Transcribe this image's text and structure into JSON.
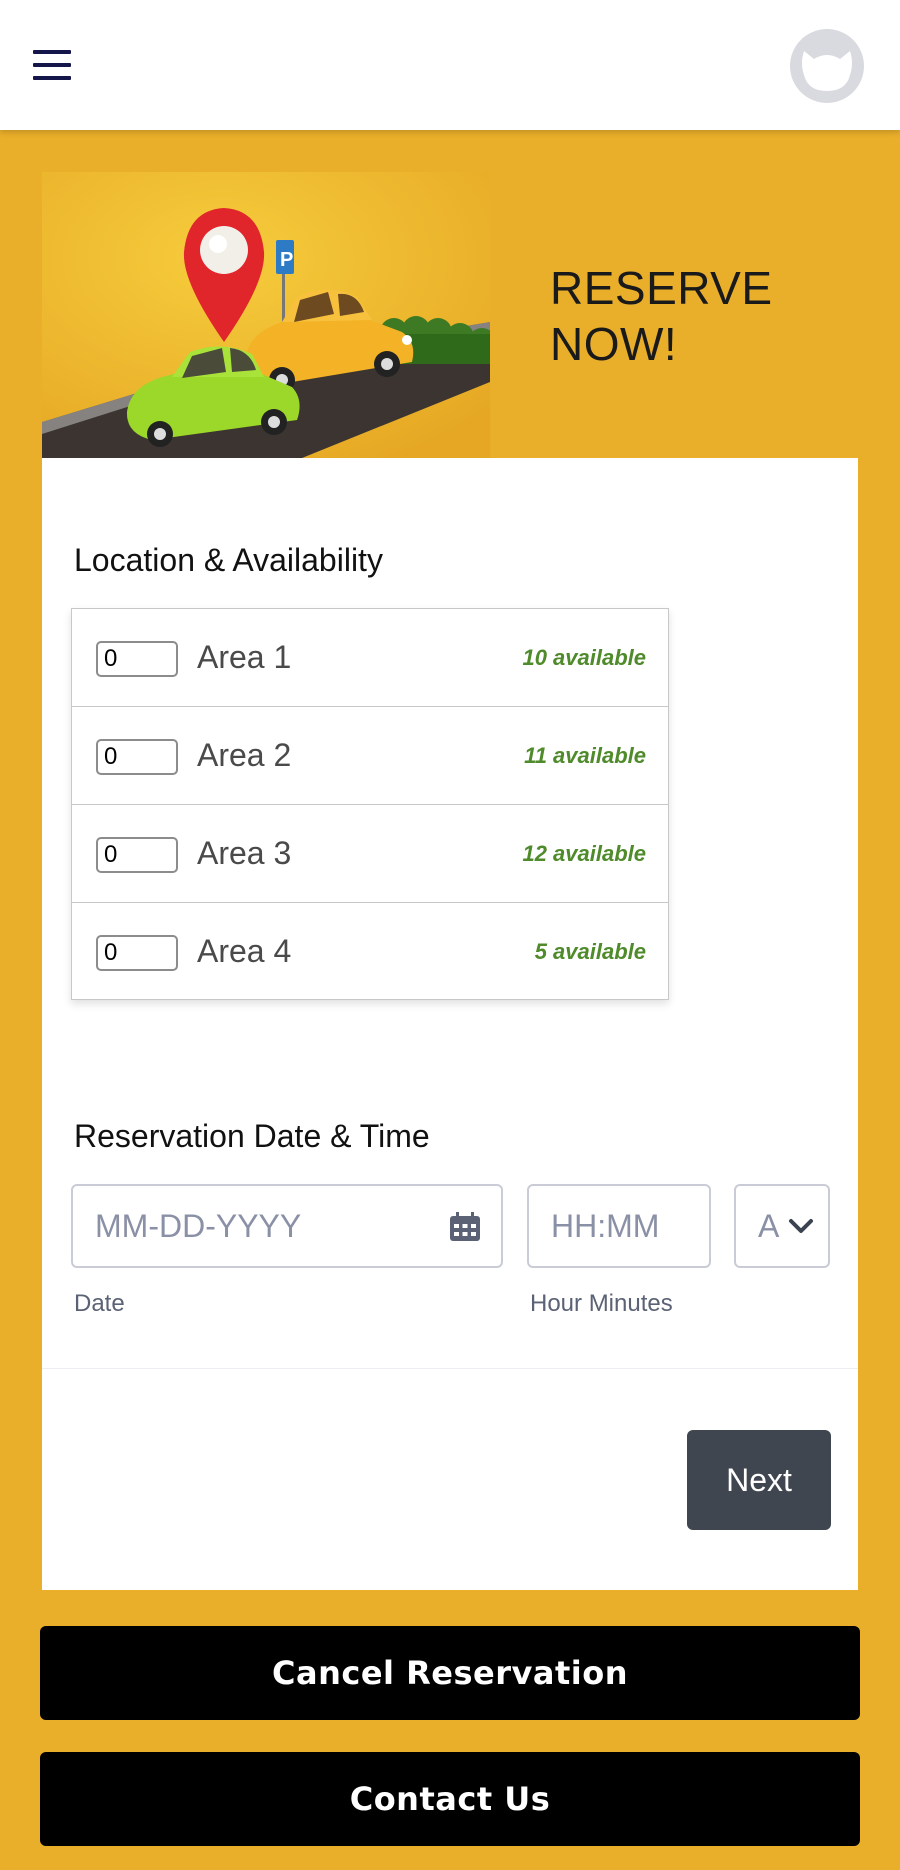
{
  "header": {
    "menu_icon": "hamburger-menu-icon",
    "avatar_icon": "user-avatar-icon"
  },
  "hero": {
    "title": "RESERVE NOW!",
    "image_icon": "parking-cars-illustration"
  },
  "form": {
    "location_heading": "Location & Availability",
    "areas": [
      {
        "qty": "0",
        "label": "Area 1",
        "available": "10 available"
      },
      {
        "qty": "0",
        "label": "Area 2",
        "available": "11 available"
      },
      {
        "qty": "0",
        "label": "Area 3",
        "available": "12 available"
      },
      {
        "qty": "0",
        "label": "Area 4",
        "available": "5 available"
      }
    ],
    "datetime_heading": "Reservation Date & Time",
    "date_placeholder": "MM-DD-YYYY",
    "date_label": "Date",
    "time_placeholder": "HH:MM",
    "time_label": "Hour Minutes",
    "ampm_value": "A",
    "next_label": "Next"
  },
  "actions": {
    "cancel_label": "Cancel Reservation",
    "contact_label": "Contact Us"
  },
  "colors": {
    "background": "#e9ae2a",
    "available_text": "#4f8a2b",
    "next_button": "#40464f",
    "action_button": "#000000"
  }
}
